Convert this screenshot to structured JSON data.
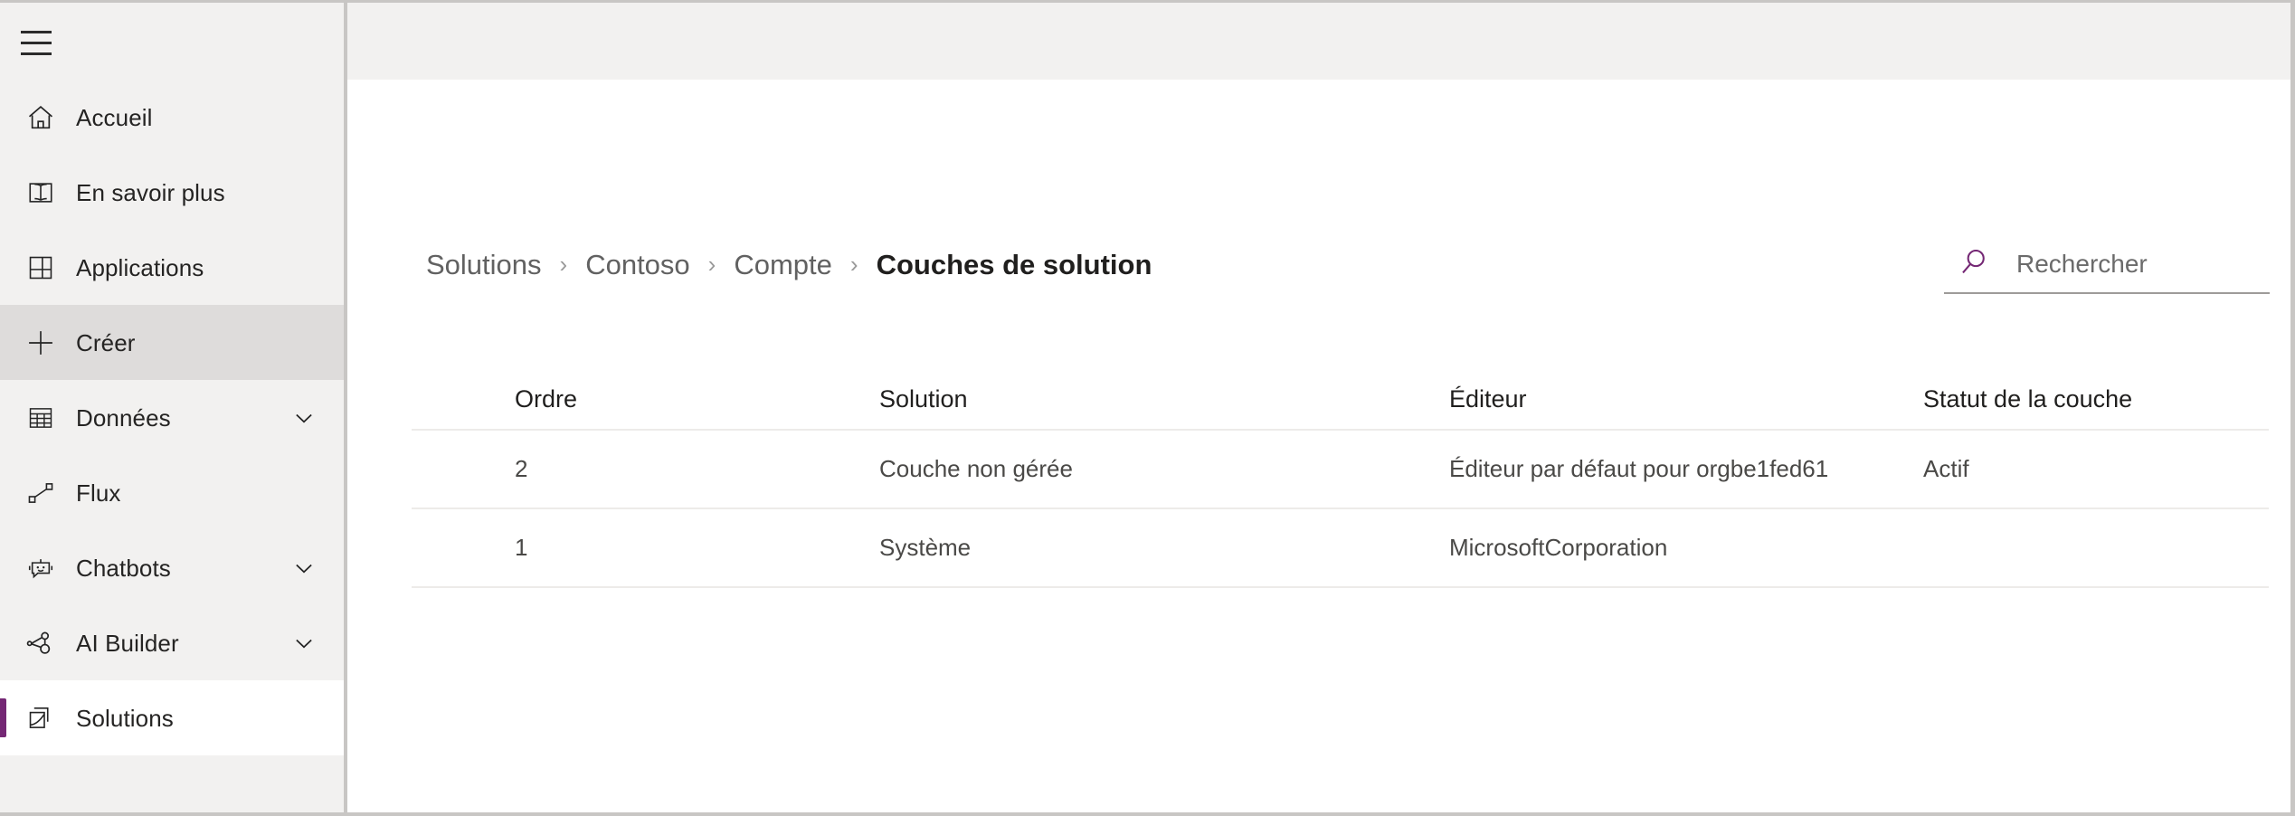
{
  "app": {
    "locale": "fr-FR",
    "accent_purple": "#742774",
    "sidebar_bg": "#f2f1f0",
    "hover_bg": "#dedcdb"
  },
  "sidebar": {
    "menu_button": "menu-icon",
    "items": [
      {
        "label": "Accueil",
        "icon": "home-icon",
        "state": "normal",
        "chevron": false
      },
      {
        "label": "En savoir plus",
        "icon": "book-icon",
        "state": "normal",
        "chevron": false
      },
      {
        "label": "Applications",
        "icon": "apps-grid-icon",
        "state": "normal",
        "chevron": false
      },
      {
        "label": "Créer",
        "icon": "plus-icon",
        "state": "hovered",
        "chevron": false
      },
      {
        "label": "Données",
        "icon": "table-icon",
        "state": "normal",
        "chevron": true
      },
      {
        "label": "Flux",
        "icon": "flow-icon",
        "state": "normal",
        "chevron": false
      },
      {
        "label": "Chatbots",
        "icon": "robot-icon",
        "state": "normal",
        "chevron": true
      },
      {
        "label": "AI Builder",
        "icon": "ai-builder-icon",
        "state": "normal",
        "chevron": true
      },
      {
        "label": "Solutions",
        "icon": "solutions-icon",
        "state": "selected",
        "chevron": false
      }
    ]
  },
  "breadcrumb": {
    "separator": "›",
    "items": [
      {
        "label": "Solutions",
        "current": false
      },
      {
        "label": "Contoso",
        "current": false
      },
      {
        "label": "Compte",
        "current": false
      },
      {
        "label": "Couches de solution",
        "current": true
      }
    ]
  },
  "search": {
    "placeholder": "Rechercher",
    "value": "",
    "icon": "search-icon"
  },
  "table": {
    "columns": [
      "Ordre",
      "Solution",
      "Éditeur",
      "Statut de la couche"
    ],
    "rows": [
      {
        "ordre": "2",
        "solution": "Couche non gérée",
        "editeur": "Éditeur par défaut pour orgbe1fed61",
        "statut": "Actif"
      },
      {
        "ordre": "1",
        "solution": "Système",
        "editeur": "MicrosoftCorporation",
        "statut": ""
      }
    ]
  }
}
